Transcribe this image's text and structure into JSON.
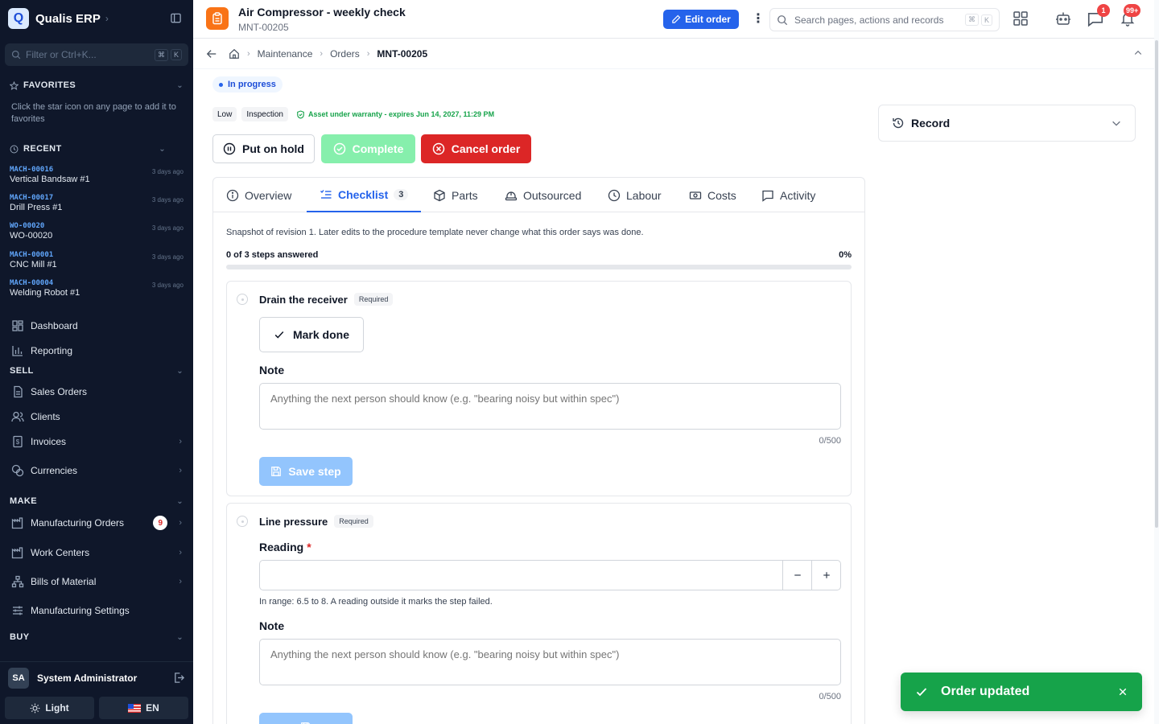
{
  "app": {
    "logo_letter": "Q",
    "name": "Qualis ERP"
  },
  "sidebar": {
    "filter_placeholder": "Filter or Ctrl+K...",
    "filter_keys": [
      "⌘",
      "K"
    ],
    "favorites": {
      "title": "FAVORITES",
      "note": "Click the star icon on any page to add it to favorites"
    },
    "recent": {
      "title": "RECENT",
      "items": [
        {
          "code": "MACH-00016",
          "name": "Vertical Bandsaw #1",
          "time": "3 days ago"
        },
        {
          "code": "MACH-00017",
          "name": "Drill Press #1",
          "time": "3 days ago"
        },
        {
          "code": "WO-00020",
          "name": "WO-00020",
          "time": "3 days ago"
        },
        {
          "code": "MACH-00001",
          "name": "CNC Mill #1",
          "time": "3 days ago"
        },
        {
          "code": "MACH-00004",
          "name": "Welding Robot #1",
          "time": "3 days ago"
        }
      ]
    },
    "top_nav": [
      {
        "label": "Dashboard"
      },
      {
        "label": "Reporting"
      }
    ],
    "sections": {
      "sell": {
        "title": "SELL",
        "items": [
          {
            "label": "Sales Orders"
          },
          {
            "label": "Clients"
          },
          {
            "label": "Invoices"
          },
          {
            "label": "Currencies"
          }
        ]
      },
      "make": {
        "title": "MAKE",
        "items": [
          {
            "label": "Manufacturing Orders",
            "badge": "9"
          },
          {
            "label": "Work Centers"
          },
          {
            "label": "Bills of Material"
          },
          {
            "label": "Manufacturing Settings"
          }
        ]
      },
      "buy": {
        "title": "BUY"
      }
    },
    "user": {
      "initials": "SA",
      "name": "System Administrator"
    },
    "theme_label": "Light",
    "lang_label": "EN"
  },
  "header": {
    "title": "Air Compressor - weekly check",
    "subtitle": "MNT-00205",
    "edit_label": "Edit order",
    "search_placeholder": "Search pages, actions and records",
    "search_keys": [
      "⌘",
      "K"
    ],
    "messages_badge": "1",
    "notifications_badge": "99+"
  },
  "breadcrumb": {
    "items": [
      "Maintenance",
      "Orders"
    ],
    "current": "MNT-00205"
  },
  "order": {
    "status": "In progress",
    "tags": [
      "Low",
      "Inspection"
    ],
    "warranty": "Asset under warranty - expires Jun 14, 2027, 11:29 PM",
    "actions": {
      "hold": "Put on hold",
      "complete": "Complete",
      "cancel": "Cancel order"
    }
  },
  "record_panel": {
    "label": "Record"
  },
  "tabs": [
    {
      "label": "Overview"
    },
    {
      "label": "Checklist",
      "count": "3"
    },
    {
      "label": "Parts"
    },
    {
      "label": "Outsourced"
    },
    {
      "label": "Labour"
    },
    {
      "label": "Costs"
    },
    {
      "label": "Activity"
    }
  ],
  "checklist": {
    "snapshot_note": "Snapshot of revision 1. Later edits to the procedure template never change what this order says was done.",
    "progress_label": "0 of 3 steps answered",
    "progress_pct": "0%",
    "progress_value": 0,
    "steps": [
      {
        "title": "Drain the receiver",
        "required_label": "Required",
        "mark_done_label": "Mark done",
        "note_label": "Note",
        "note_placeholder": "Anything the next person should know (e.g. \"bearing noisy but within spec\")",
        "counter": "0/500",
        "save_label": "Save step"
      },
      {
        "title": "Line pressure",
        "required_label": "Required",
        "reading_label": "Reading",
        "reading_required_mark": "*",
        "range_hint": "In range: 6.5 to 8. A reading outside it marks the step failed.",
        "note_label": "Note",
        "note_placeholder": "Anything the next person should know (e.g. \"bearing noisy but within spec\")",
        "counter": "0/500"
      }
    ]
  },
  "toast": {
    "message": "Order updated"
  }
}
